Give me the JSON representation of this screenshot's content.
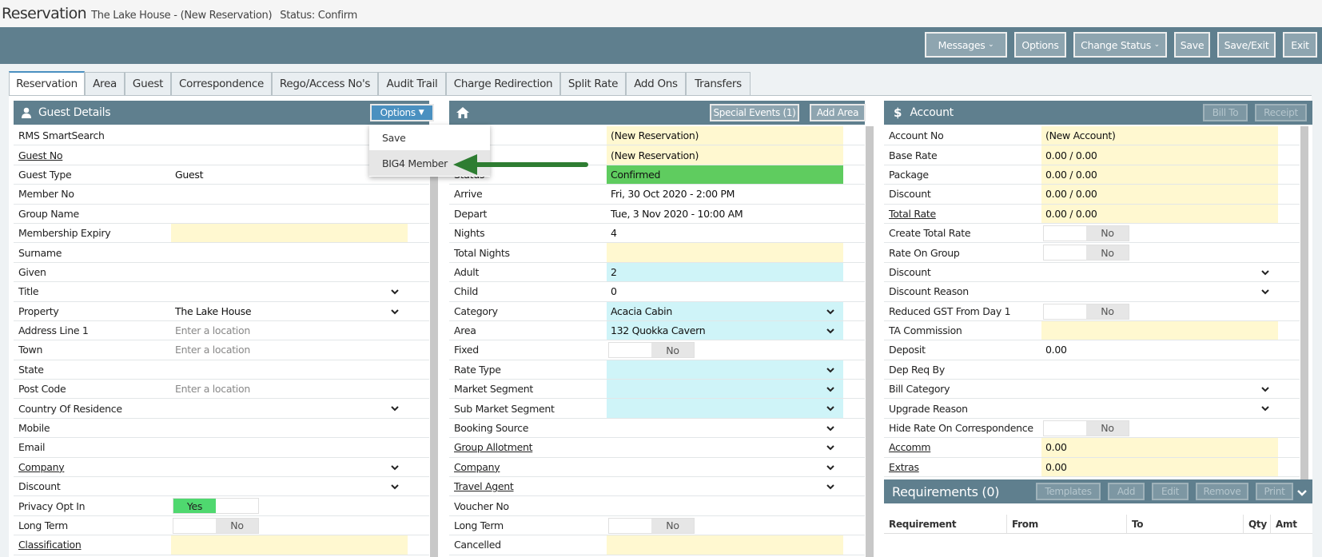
{
  "window": {
    "title": "Reservation",
    "property": "The Lake House -",
    "reservation": "(New Reservation)",
    "status": "Status: Confirm"
  },
  "toolbar": {
    "messages": "Messages",
    "options": "Options",
    "change_status": "Change Status",
    "save": "Save",
    "save_exit": "Save/Exit",
    "exit": "Exit"
  },
  "tabs": [
    "Reservation",
    "Area",
    "Guest",
    "Correspondence",
    "Rego/Access No's",
    "Audit Trail",
    "Charge Redirection",
    "Split Rate",
    "Add Ons",
    "Transfers"
  ],
  "guest": {
    "title": "Guest Details",
    "options": "Options",
    "rows": [
      {
        "label": "RMS SmartSearch",
        "value": "",
        "search": true
      },
      {
        "label": "Guest No",
        "value": "",
        "search": true,
        "link": true
      },
      {
        "label": "Guest Type",
        "value": "Guest"
      },
      {
        "label": "Member No",
        "value": "",
        "search": true
      },
      {
        "label": "Group Name",
        "value": "",
        "search": true
      },
      {
        "label": "Membership Expiry",
        "value": "",
        "bg": "yellow"
      },
      {
        "label": "Surname",
        "value": "",
        "search": true
      },
      {
        "label": "Given",
        "value": "",
        "search": true
      },
      {
        "label": "Title",
        "value": "",
        "chev": true
      },
      {
        "label": "Property",
        "value": "The Lake House",
        "chev": true
      },
      {
        "label": "Address Line 1",
        "value": "",
        "placeholder": "Enter a location"
      },
      {
        "label": "Town",
        "value": "",
        "placeholder": "Enter a location"
      },
      {
        "label": "State",
        "value": ""
      },
      {
        "label": "Post Code",
        "value": "",
        "placeholder": "Enter a location",
        "search": true
      },
      {
        "label": "Country Of Residence",
        "value": "",
        "chev": true
      },
      {
        "label": "Mobile",
        "value": "",
        "search": true
      },
      {
        "label": "Email",
        "value": "",
        "search": true
      },
      {
        "label": "Company",
        "value": "",
        "chev": true,
        "link": true
      },
      {
        "label": "Discount",
        "value": "",
        "chev": true
      },
      {
        "label": "Privacy Opt In",
        "toggle": "Yes"
      },
      {
        "label": "Long Term",
        "toggle": "No"
      },
      {
        "label": "Classification",
        "value": "",
        "bg": "yellow",
        "link": true
      }
    ]
  },
  "dropdown": {
    "items": [
      "Save",
      "BIG4 Member"
    ]
  },
  "reservation": {
    "special_events": "Special Events (1)",
    "add_area": "Add Area",
    "rows": [
      {
        "label": "",
        "value": "(New Reservation)",
        "bg": "yellow"
      },
      {
        "label": "s No",
        "value": "(New Reservation)",
        "bg": "yellow"
      },
      {
        "label": "Status",
        "value": "Confirmed",
        "bg": "green"
      },
      {
        "label": "Arrive",
        "value": "Fri, 30 Oct 2020 - 2:00 PM"
      },
      {
        "label": "Depart",
        "value": "Tue, 3 Nov 2020 - 10:00 AM"
      },
      {
        "label": "Nights",
        "value": "4"
      },
      {
        "label": "Total Nights",
        "value": "",
        "bg": "yellow"
      },
      {
        "label": "Adult",
        "value": "2",
        "bg": "cyan"
      },
      {
        "label": "Child",
        "value": "0"
      },
      {
        "label": "Category",
        "value": "Acacia Cabin",
        "bg": "cyan",
        "chev": true
      },
      {
        "label": "Area",
        "value": "132 Quokka Cavern",
        "bg": "cyan",
        "chev": true
      },
      {
        "label": "Fixed",
        "toggle": "No"
      },
      {
        "label": "Rate Type",
        "value": "",
        "bg": "cyan",
        "chev": true
      },
      {
        "label": "Market Segment",
        "value": "",
        "bg": "cyan",
        "chev": true
      },
      {
        "label": "Sub Market Segment",
        "value": "",
        "bg": "cyan",
        "chev": true
      },
      {
        "label": "Booking Source",
        "value": "",
        "chev": true
      },
      {
        "label": "Group Allotment",
        "value": "",
        "chev": true,
        "link": true
      },
      {
        "label": "Company",
        "value": "",
        "chev": true,
        "link": true,
        "search": true
      },
      {
        "label": "Travel Agent",
        "value": "",
        "chev": true,
        "link": true,
        "search": true
      },
      {
        "label": "Voucher No",
        "value": ""
      },
      {
        "label": "Long Term",
        "toggle": "No"
      },
      {
        "label": "Cancelled",
        "value": "",
        "bg": "yellow"
      }
    ]
  },
  "account": {
    "title": "Account",
    "bill_to": "Bill To",
    "receipt": "Receipt",
    "rows": [
      {
        "label": "Account No",
        "value": "(New Account)",
        "bg": "yellow"
      },
      {
        "label": "Base Rate",
        "value": "0.00 / 0.00",
        "bg": "yellow"
      },
      {
        "label": "Package",
        "value": "0.00 / 0.00",
        "bg": "yellow"
      },
      {
        "label": "Discount",
        "value": "0.00 / 0.00",
        "bg": "yellow"
      },
      {
        "label": "Total Rate",
        "value": "0.00 / 0.00",
        "bg": "yellow",
        "link": true
      },
      {
        "label": "Create Total Rate",
        "toggle": "No"
      },
      {
        "label": "Rate On Group",
        "toggle": "No"
      },
      {
        "label": "Discount",
        "value": "",
        "chev": true
      },
      {
        "label": "Discount Reason",
        "value": "",
        "chev": true
      },
      {
        "label": "Reduced GST From Day 1",
        "toggle": "No"
      },
      {
        "label": "TA Commission",
        "value": "",
        "bg": "yellow"
      },
      {
        "label": "Deposit",
        "value": "0.00"
      },
      {
        "label": "Dep Req By",
        "value": ""
      },
      {
        "label": "Bill Category",
        "value": "",
        "chev": true
      },
      {
        "label": "Upgrade Reason",
        "value": "",
        "chev": true
      },
      {
        "label": "Hide Rate On Correspondence",
        "toggle": "No"
      },
      {
        "label": "Accomm",
        "value": "0.00",
        "bg": "yellow",
        "link": true
      },
      {
        "label": "Extras",
        "value": "0.00",
        "bg": "yellow",
        "link": true
      }
    ]
  },
  "requirements": {
    "title": "Requirements (0)",
    "buttons": [
      "Templates",
      "Add",
      "Edit",
      "Remove",
      "Print"
    ],
    "columns": [
      "Requirement",
      "From",
      "To",
      "Qty",
      "Amt"
    ]
  },
  "colors": {
    "header": "#5f7f8e",
    "yellow": "#fff8d0",
    "cyan": "#cff4f8",
    "green": "#5fcc5f",
    "accent": "#4a90c0"
  }
}
